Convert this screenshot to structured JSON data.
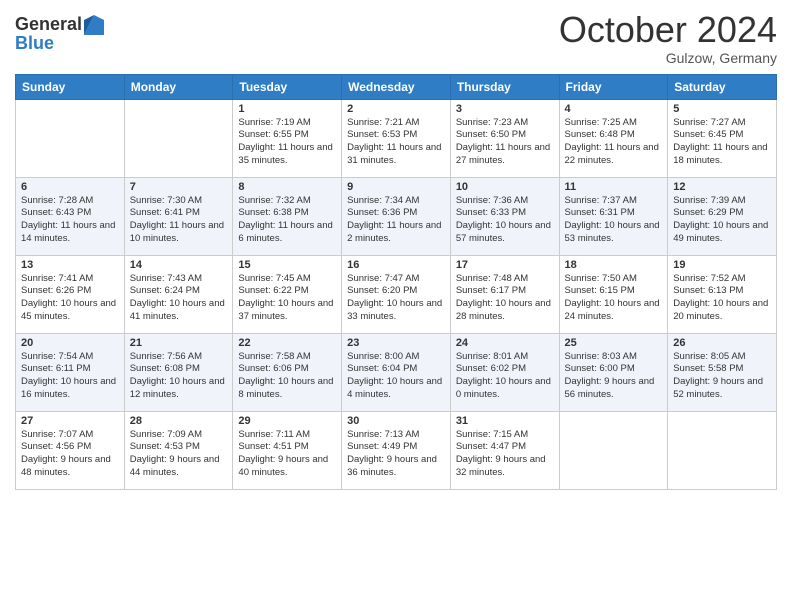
{
  "header": {
    "logo_line1": "General",
    "logo_line2": "Blue",
    "month_title": "October 2024",
    "location": "Gulzow, Germany"
  },
  "weekdays": [
    "Sunday",
    "Monday",
    "Tuesday",
    "Wednesday",
    "Thursday",
    "Friday",
    "Saturday"
  ],
  "rows": [
    [
      {
        "day": "",
        "sunrise": "",
        "sunset": "",
        "daylight": ""
      },
      {
        "day": "",
        "sunrise": "",
        "sunset": "",
        "daylight": ""
      },
      {
        "day": "1",
        "sunrise": "Sunrise: 7:19 AM",
        "sunset": "Sunset: 6:55 PM",
        "daylight": "Daylight: 11 hours and 35 minutes."
      },
      {
        "day": "2",
        "sunrise": "Sunrise: 7:21 AM",
        "sunset": "Sunset: 6:53 PM",
        "daylight": "Daylight: 11 hours and 31 minutes."
      },
      {
        "day": "3",
        "sunrise": "Sunrise: 7:23 AM",
        "sunset": "Sunset: 6:50 PM",
        "daylight": "Daylight: 11 hours and 27 minutes."
      },
      {
        "day": "4",
        "sunrise": "Sunrise: 7:25 AM",
        "sunset": "Sunset: 6:48 PM",
        "daylight": "Daylight: 11 hours and 22 minutes."
      },
      {
        "day": "5",
        "sunrise": "Sunrise: 7:27 AM",
        "sunset": "Sunset: 6:45 PM",
        "daylight": "Daylight: 11 hours and 18 minutes."
      }
    ],
    [
      {
        "day": "6",
        "sunrise": "Sunrise: 7:28 AM",
        "sunset": "Sunset: 6:43 PM",
        "daylight": "Daylight: 11 hours and 14 minutes."
      },
      {
        "day": "7",
        "sunrise": "Sunrise: 7:30 AM",
        "sunset": "Sunset: 6:41 PM",
        "daylight": "Daylight: 11 hours and 10 minutes."
      },
      {
        "day": "8",
        "sunrise": "Sunrise: 7:32 AM",
        "sunset": "Sunset: 6:38 PM",
        "daylight": "Daylight: 11 hours and 6 minutes."
      },
      {
        "day": "9",
        "sunrise": "Sunrise: 7:34 AM",
        "sunset": "Sunset: 6:36 PM",
        "daylight": "Daylight: 11 hours and 2 minutes."
      },
      {
        "day": "10",
        "sunrise": "Sunrise: 7:36 AM",
        "sunset": "Sunset: 6:33 PM",
        "daylight": "Daylight: 10 hours and 57 minutes."
      },
      {
        "day": "11",
        "sunrise": "Sunrise: 7:37 AM",
        "sunset": "Sunset: 6:31 PM",
        "daylight": "Daylight: 10 hours and 53 minutes."
      },
      {
        "day": "12",
        "sunrise": "Sunrise: 7:39 AM",
        "sunset": "Sunset: 6:29 PM",
        "daylight": "Daylight: 10 hours and 49 minutes."
      }
    ],
    [
      {
        "day": "13",
        "sunrise": "Sunrise: 7:41 AM",
        "sunset": "Sunset: 6:26 PM",
        "daylight": "Daylight: 10 hours and 45 minutes."
      },
      {
        "day": "14",
        "sunrise": "Sunrise: 7:43 AM",
        "sunset": "Sunset: 6:24 PM",
        "daylight": "Daylight: 10 hours and 41 minutes."
      },
      {
        "day": "15",
        "sunrise": "Sunrise: 7:45 AM",
        "sunset": "Sunset: 6:22 PM",
        "daylight": "Daylight: 10 hours and 37 minutes."
      },
      {
        "day": "16",
        "sunrise": "Sunrise: 7:47 AM",
        "sunset": "Sunset: 6:20 PM",
        "daylight": "Daylight: 10 hours and 33 minutes."
      },
      {
        "day": "17",
        "sunrise": "Sunrise: 7:48 AM",
        "sunset": "Sunset: 6:17 PM",
        "daylight": "Daylight: 10 hours and 28 minutes."
      },
      {
        "day": "18",
        "sunrise": "Sunrise: 7:50 AM",
        "sunset": "Sunset: 6:15 PM",
        "daylight": "Daylight: 10 hours and 24 minutes."
      },
      {
        "day": "19",
        "sunrise": "Sunrise: 7:52 AM",
        "sunset": "Sunset: 6:13 PM",
        "daylight": "Daylight: 10 hours and 20 minutes."
      }
    ],
    [
      {
        "day": "20",
        "sunrise": "Sunrise: 7:54 AM",
        "sunset": "Sunset: 6:11 PM",
        "daylight": "Daylight: 10 hours and 16 minutes."
      },
      {
        "day": "21",
        "sunrise": "Sunrise: 7:56 AM",
        "sunset": "Sunset: 6:08 PM",
        "daylight": "Daylight: 10 hours and 12 minutes."
      },
      {
        "day": "22",
        "sunrise": "Sunrise: 7:58 AM",
        "sunset": "Sunset: 6:06 PM",
        "daylight": "Daylight: 10 hours and 8 minutes."
      },
      {
        "day": "23",
        "sunrise": "Sunrise: 8:00 AM",
        "sunset": "Sunset: 6:04 PM",
        "daylight": "Daylight: 10 hours and 4 minutes."
      },
      {
        "day": "24",
        "sunrise": "Sunrise: 8:01 AM",
        "sunset": "Sunset: 6:02 PM",
        "daylight": "Daylight: 10 hours and 0 minutes."
      },
      {
        "day": "25",
        "sunrise": "Sunrise: 8:03 AM",
        "sunset": "Sunset: 6:00 PM",
        "daylight": "Daylight: 9 hours and 56 minutes."
      },
      {
        "day": "26",
        "sunrise": "Sunrise: 8:05 AM",
        "sunset": "Sunset: 5:58 PM",
        "daylight": "Daylight: 9 hours and 52 minutes."
      }
    ],
    [
      {
        "day": "27",
        "sunrise": "Sunrise: 7:07 AM",
        "sunset": "Sunset: 4:56 PM",
        "daylight": "Daylight: 9 hours and 48 minutes."
      },
      {
        "day": "28",
        "sunrise": "Sunrise: 7:09 AM",
        "sunset": "Sunset: 4:53 PM",
        "daylight": "Daylight: 9 hours and 44 minutes."
      },
      {
        "day": "29",
        "sunrise": "Sunrise: 7:11 AM",
        "sunset": "Sunset: 4:51 PM",
        "daylight": "Daylight: 9 hours and 40 minutes."
      },
      {
        "day": "30",
        "sunrise": "Sunrise: 7:13 AM",
        "sunset": "Sunset: 4:49 PM",
        "daylight": "Daylight: 9 hours and 36 minutes."
      },
      {
        "day": "31",
        "sunrise": "Sunrise: 7:15 AM",
        "sunset": "Sunset: 4:47 PM",
        "daylight": "Daylight: 9 hours and 32 minutes."
      },
      {
        "day": "",
        "sunrise": "",
        "sunset": "",
        "daylight": ""
      },
      {
        "day": "",
        "sunrise": "",
        "sunset": "",
        "daylight": ""
      }
    ]
  ]
}
